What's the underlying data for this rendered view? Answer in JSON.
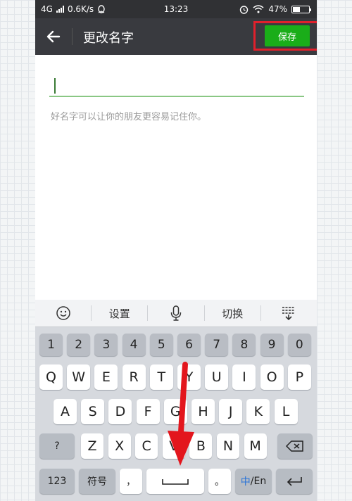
{
  "status_bar": {
    "network": "4G",
    "speed": "0.6K/s",
    "time": "13:23",
    "battery": "47%",
    "battery_level": 0.47
  },
  "header": {
    "title": "更改名字",
    "save_label": "保存"
  },
  "form": {
    "name_value": "",
    "hint": "好名字可以让你的朋友更容易记住你。"
  },
  "keyboard": {
    "toolbar": {
      "settings_label": "设置",
      "switch_label": "切换"
    },
    "number_row": [
      "1",
      "2",
      "3",
      "4",
      "5",
      "6",
      "7",
      "8",
      "9",
      "0"
    ],
    "row1": [
      "Q",
      "W",
      "E",
      "R",
      "T",
      "Y",
      "U",
      "I",
      "O",
      "P"
    ],
    "row2": [
      "A",
      "S",
      "D",
      "F",
      "G",
      "H",
      "J",
      "K",
      "L"
    ],
    "row3": [
      "Z",
      "X",
      "C",
      "V",
      "B",
      "N",
      "M"
    ],
    "shift_label": "?",
    "mode_123_label": "123",
    "symbol_label": "符号",
    "comma_label": "，",
    "space_label": "␣",
    "period_label": "。",
    "lang_label_zh": "中",
    "lang_label_en": "/En"
  },
  "colors": {
    "title_bar": "#393a3f",
    "save_green": "#1aad19",
    "highlight_red": "#e0202c"
  }
}
